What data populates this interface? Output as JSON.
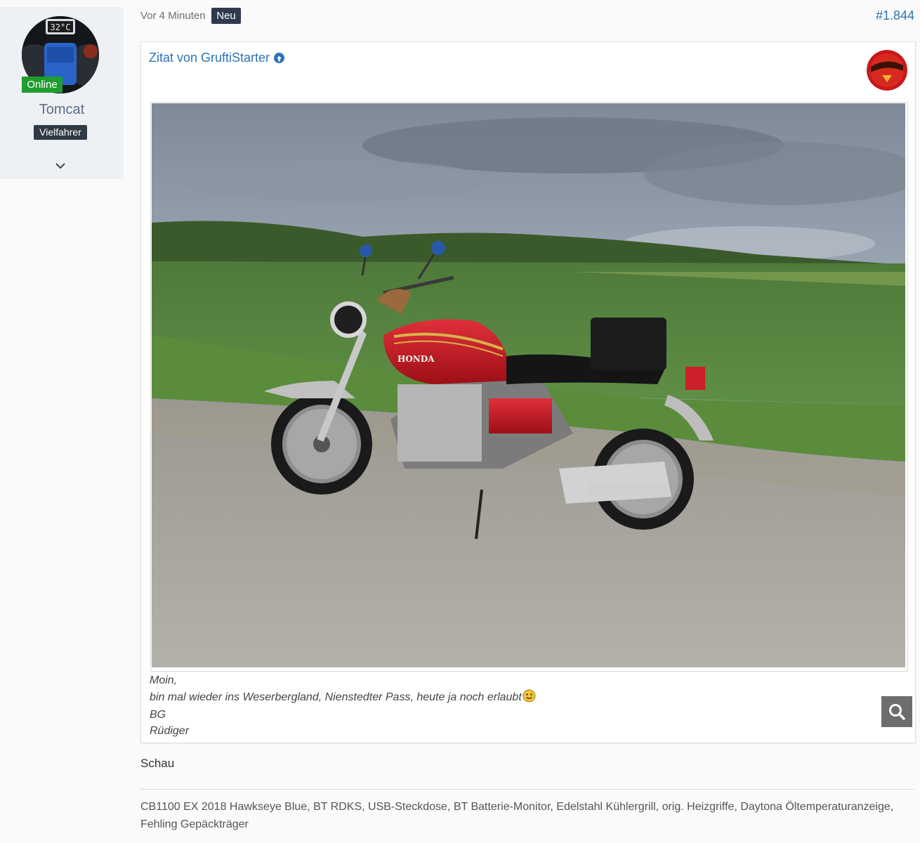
{
  "author": {
    "online_label": "Online",
    "username": "Tomcat",
    "rank": "Vielfahrer",
    "avatar_readout": "32°C"
  },
  "post": {
    "time": "Vor 4 Minuten",
    "new_badge": "Neu",
    "number": "#1.844"
  },
  "quote": {
    "title": "Zitat von GruftiStarter",
    "lines": [
      "Moin,",
      "bin mal wieder ins Weserbergland, Nienstedter Pass, heute ja noch erlaubt",
      "BG",
      "Rüdiger"
    ],
    "photo_brand": "HONDA"
  },
  "reply": "Schau",
  "signature": "CB1100 EX 2018 Hawkseye Blue, BT RDKS, USB-Steckdose, BT Batterie-Monitor, Edelstahl Kühlergrill, orig. Heizgriffe, Daytona Öltemperaturanzeige, Fehling Gepäckträger",
  "colors": {
    "link": "#2a73b5",
    "online": "#1f9d2f",
    "badge": "#2f3a4f",
    "sidebar": "#eef1f4"
  }
}
